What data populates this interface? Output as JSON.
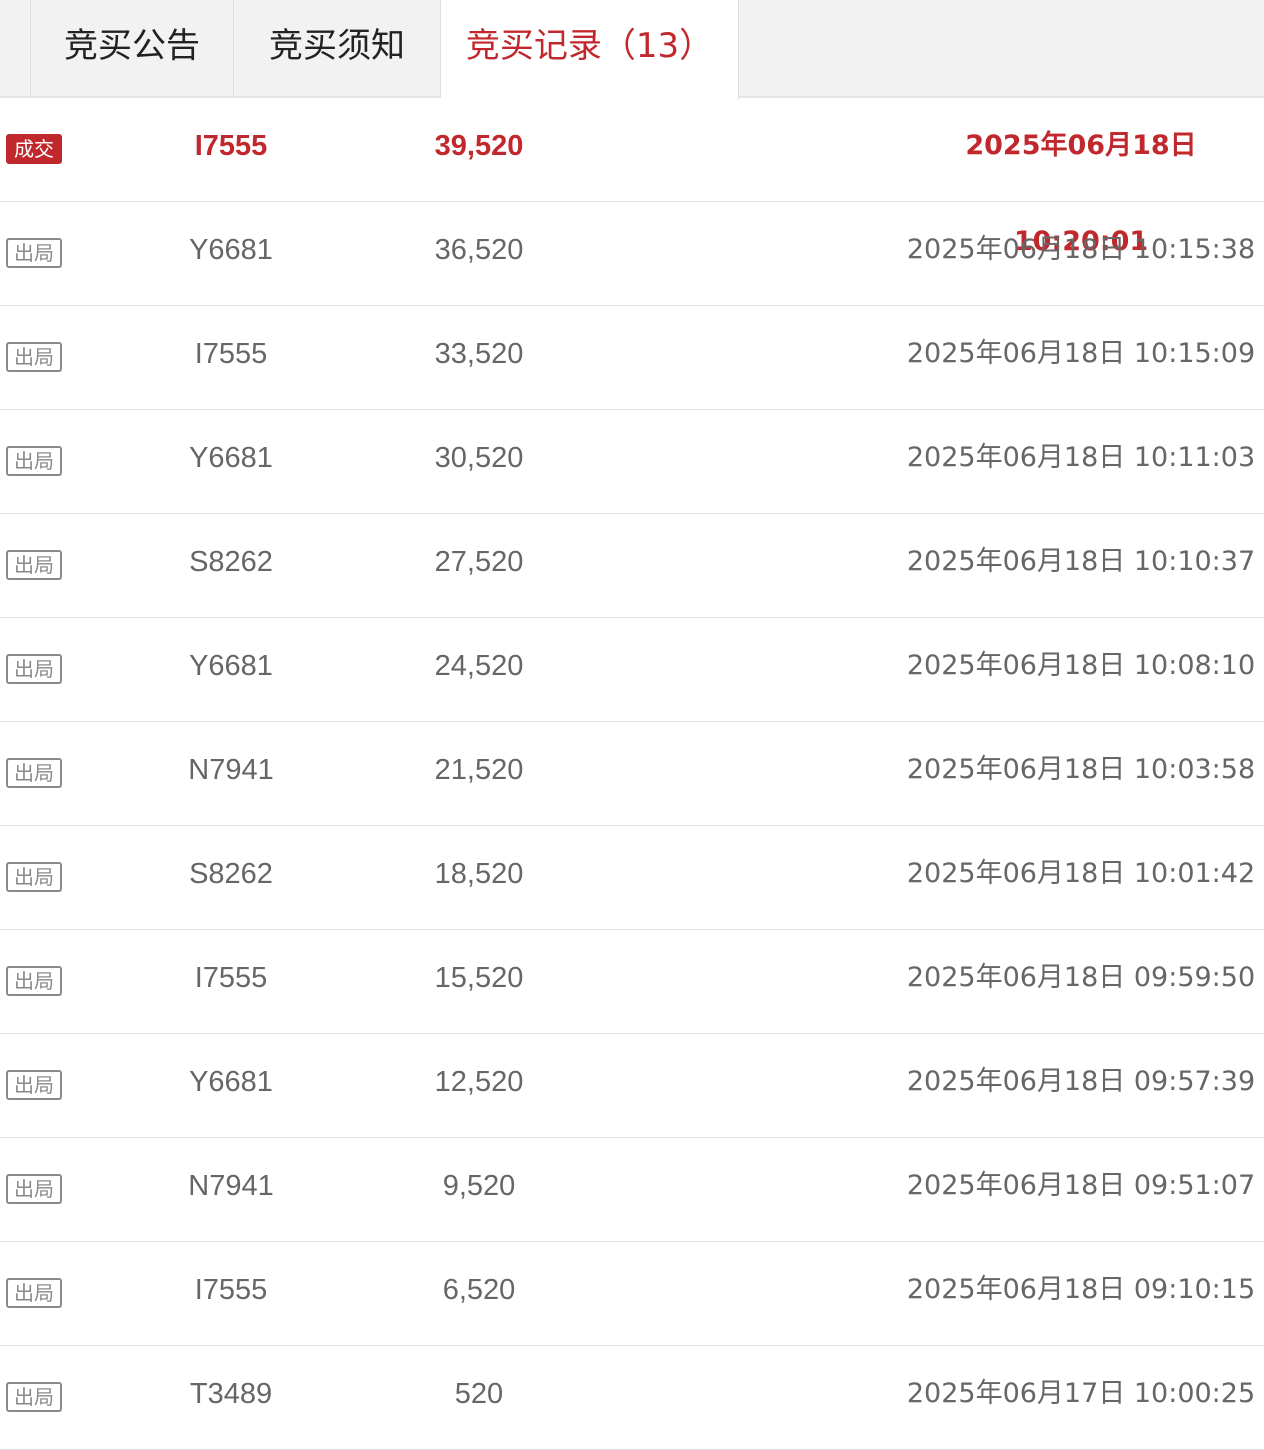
{
  "tabs": [
    {
      "label": "竞买公告"
    },
    {
      "label": "竞买须知"
    },
    {
      "label": "竞买记录（13）"
    }
  ],
  "colors": {
    "accent": "#c0282d",
    "text_muted": "#666666",
    "badge_gray": "#8a8a8a"
  },
  "records": [
    {
      "status": "成交",
      "bidder": "I7555",
      "price": "39,520",
      "time": "2025年06月18日 10:20:01"
    },
    {
      "status": "出局",
      "bidder": "Y6681",
      "price": "36,520",
      "time": "2025年06月18日 10:15:38"
    },
    {
      "status": "出局",
      "bidder": "I7555",
      "price": "33,520",
      "time": "2025年06月18日 10:15:09"
    },
    {
      "status": "出局",
      "bidder": "Y6681",
      "price": "30,520",
      "time": "2025年06月18日 10:11:03"
    },
    {
      "status": "出局",
      "bidder": "S8262",
      "price": "27,520",
      "time": "2025年06月18日 10:10:37"
    },
    {
      "status": "出局",
      "bidder": "Y6681",
      "price": "24,520",
      "time": "2025年06月18日 10:08:10"
    },
    {
      "status": "出局",
      "bidder": "N7941",
      "price": "21,520",
      "time": "2025年06月18日 10:03:58"
    },
    {
      "status": "出局",
      "bidder": "S8262",
      "price": "18,520",
      "time": "2025年06月18日 10:01:42"
    },
    {
      "status": "出局",
      "bidder": "I7555",
      "price": "15,520",
      "time": "2025年06月18日 09:59:50"
    },
    {
      "status": "出局",
      "bidder": "Y6681",
      "price": "12,520",
      "time": "2025年06月18日 09:57:39"
    },
    {
      "status": "出局",
      "bidder": "N7941",
      "price": "9,520",
      "time": "2025年06月18日 09:51:07"
    },
    {
      "status": "出局",
      "bidder": "I7555",
      "price": "6,520",
      "time": "2025年06月18日 09:10:15"
    },
    {
      "status": "出局",
      "bidder": "T3489",
      "price": "520",
      "time": "2025年06月17日 10:00:25"
    }
  ]
}
